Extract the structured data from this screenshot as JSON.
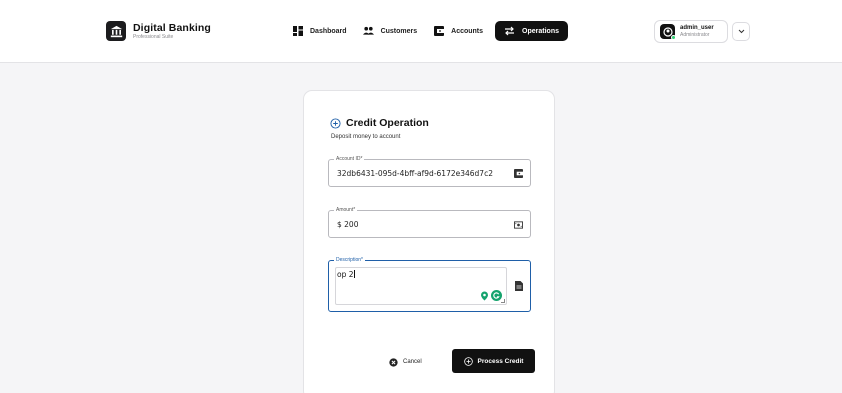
{
  "brand": {
    "title": "Digital Banking",
    "subtitle": "Professional Suite"
  },
  "nav": {
    "items": [
      {
        "label": "Dashboard",
        "icon": "dashboard-icon"
      },
      {
        "label": "Customers",
        "icon": "customers-icon"
      },
      {
        "label": "Accounts",
        "icon": "accounts-icon"
      },
      {
        "label": "Operations",
        "icon": "operations-icon",
        "active": true
      }
    ]
  },
  "user": {
    "name": "admin_user",
    "role": "Administrator",
    "status_color": "#2ecc71"
  },
  "form": {
    "title": "Credit Operation",
    "subtitle": "Deposit money to account",
    "account_id": {
      "label": "Account ID*",
      "value": "32db6431-095d-4bff-af9d-6172e346d7c2"
    },
    "amount": {
      "label": "Amount*",
      "value": "$ 200"
    },
    "description": {
      "label": "Description*",
      "value": "op 2"
    },
    "cancel_label": "Cancel",
    "submit_label": "Process Credit"
  },
  "colors": {
    "accent": "#1f5fa8",
    "primary_button": "#111111",
    "grammar_ext": "#15a36d"
  }
}
